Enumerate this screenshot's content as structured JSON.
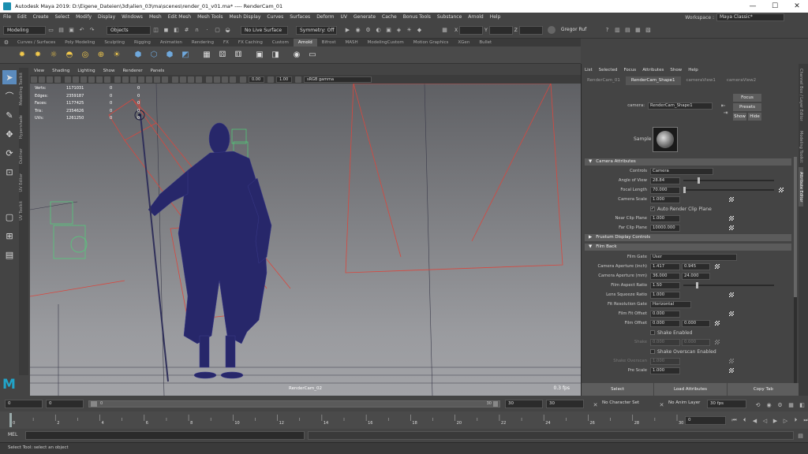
{
  "window": {
    "title": "Autodesk Maya 2019: D:\\Eigene_Dateien\\3d\\alien_03\\ma\\scenes\\render_01_v01.ma*   ----   RenderCam_01",
    "controls": [
      "—",
      "☐",
      "✕"
    ]
  },
  "menubar": {
    "items": [
      "File",
      "Edit",
      "Create",
      "Select",
      "Modify",
      "Display",
      "Windows",
      "Mesh",
      "Edit Mesh",
      "Mesh Tools",
      "Mesh Display",
      "Curves",
      "Surfaces",
      "Deform",
      "UV",
      "Generate",
      "Cache",
      "Bonus Tools",
      "Substance",
      "Arnold",
      "Help"
    ],
    "workspace_label": "Workspace :",
    "workspace_value": "Maya Classic*"
  },
  "statusline": {
    "mode": "Modeling",
    "objects_label": "Objects",
    "live_surface": "No Live Surface",
    "symmetry": "Symmetry: Off",
    "x_label": "X",
    "y_label": "Y",
    "z_label": "Z",
    "user": "Gregor Ruf"
  },
  "shelf": {
    "tabs": [
      "Curves / Surfaces",
      "Poly Modeling",
      "Sculpting",
      "Rigging",
      "Animation",
      "Rendering",
      "FX",
      "FX Caching",
      "Custom",
      "Arnold",
      "Bifrost",
      "MASH",
      "ModelingCustom",
      "Motion Graphics",
      "XGen",
      "Bullet"
    ],
    "active_tab": "Arnold"
  },
  "left_tabs": [
    "Modelling Toolkit",
    "Hypershade",
    "Outliner",
    "UV Editor",
    "UV Toolkit"
  ],
  "viewport": {
    "menu": [
      "View",
      "Shading",
      "Lighting",
      "Show",
      "Renderer",
      "Panels"
    ],
    "exposure": "0.00",
    "gamma": "1.00",
    "color_space": "sRGB gamma",
    "camera_name": "RenderCam_02",
    "fps": "0.3 fps",
    "hud": [
      {
        "label": "Verts:",
        "v1": "1171031",
        "v2": "0",
        "v3": "0"
      },
      {
        "label": "Edges:",
        "v1": "2359187",
        "v2": "0",
        "v3": "0"
      },
      {
        "label": "Faces:",
        "v1": "1177425",
        "v2": "0",
        "v3": "0"
      },
      {
        "label": "Tris:",
        "v1": "2354626",
        "v2": "0",
        "v3": "0"
      },
      {
        "label": "UVs:",
        "v1": "1261250",
        "v2": "0",
        "v3": "0"
      }
    ]
  },
  "attribute_editor": {
    "menu": [
      "List",
      "Selected",
      "Focus",
      "Attributes",
      "Show",
      "Help"
    ],
    "tabs": [
      "RenderCam_01",
      "RenderCam_Shape1",
      "cameraView1",
      "cameraView2"
    ],
    "active_tab": "RenderCam_Shape1",
    "node_label": "camera:",
    "node_value": "RenderCam_Shape1",
    "focus_btn": "Focus",
    "presets_btn": "Presets",
    "show_btn": "Show",
    "hide_btn": "Hide",
    "sample_label": "Sample",
    "sections": {
      "camera_attributes": "Camera Attributes",
      "frustum": "Frustum Display Controls",
      "film_back": "Film Back"
    },
    "camera": {
      "controls_label": "Controls",
      "controls_value": "Camera",
      "aov_label": "Angle of View",
      "aov_value": "28.84",
      "focal_label": "Focal Length",
      "focal_value": "70.000",
      "scale_label": "Camera Scale",
      "scale_value": "1.000",
      "auto_clip_label": "Auto Render Clip Plane",
      "near_label": "Near Clip Plane",
      "near_value": "1.000",
      "far_label": "Far Clip Plane",
      "far_value": "10000.000"
    },
    "film": {
      "gate_label": "Film Gate",
      "gate_value": "User",
      "ap_in_label": "Camera Aperture (inch)",
      "ap_in_1": "1.417",
      "ap_in_2": "0.945",
      "ap_mm_label": "Camera Aperture (mm)",
      "ap_mm_1": "36.000",
      "ap_mm_2": "24.000",
      "aspect_label": "Film Aspect Ratio",
      "aspect_value": "1.50",
      "squeeze_label": "Lens Squeeze Ratio",
      "squeeze_value": "1.000",
      "fit_label": "Fit Resolution Gate",
      "fit_value": "Horizontal",
      "fit_offset_label": "Film Fit Offset",
      "fit_offset_value": "0.000",
      "film_offset_label": "Film Offset",
      "film_offset_1": "0.000",
      "film_offset_2": "0.000",
      "shake_enabled_label": "Shake Enabled",
      "shake_label": "Shake",
      "shake_1": "0.000",
      "shake_2": "0.000",
      "shake_overscan_enabled_label": "Shake Overscan Enabled",
      "shake_overscan_label": "Shake Overscan",
      "shake_overscan_value": "1.000",
      "prescale_label": "Pre Scale",
      "prescale_value": "1.000"
    },
    "bottom": [
      "Select",
      "Load Attributes",
      "Copy Tab"
    ]
  },
  "right_tabs": [
    "Channel Box / Layer Editor",
    "Modeling Toolkit",
    "Attribute Editor"
  ],
  "range": {
    "start": "0",
    "inner_start": "0",
    "slider_label": "0",
    "slider_end": "30",
    "inner_end": "30",
    "end": "30",
    "character_set": "No Character Set",
    "anim_layer": "No Anim Layer",
    "fps": "30 fps"
  },
  "timeline": {
    "ticks": [
      "0",
      "2",
      "4",
      "6",
      "8",
      "10",
      "12",
      "14",
      "16",
      "18",
      "20",
      "22",
      "24",
      "26",
      "28",
      "30"
    ],
    "current": "0"
  },
  "mel_label": "MEL",
  "help_text": "Select Tool: select an object"
}
